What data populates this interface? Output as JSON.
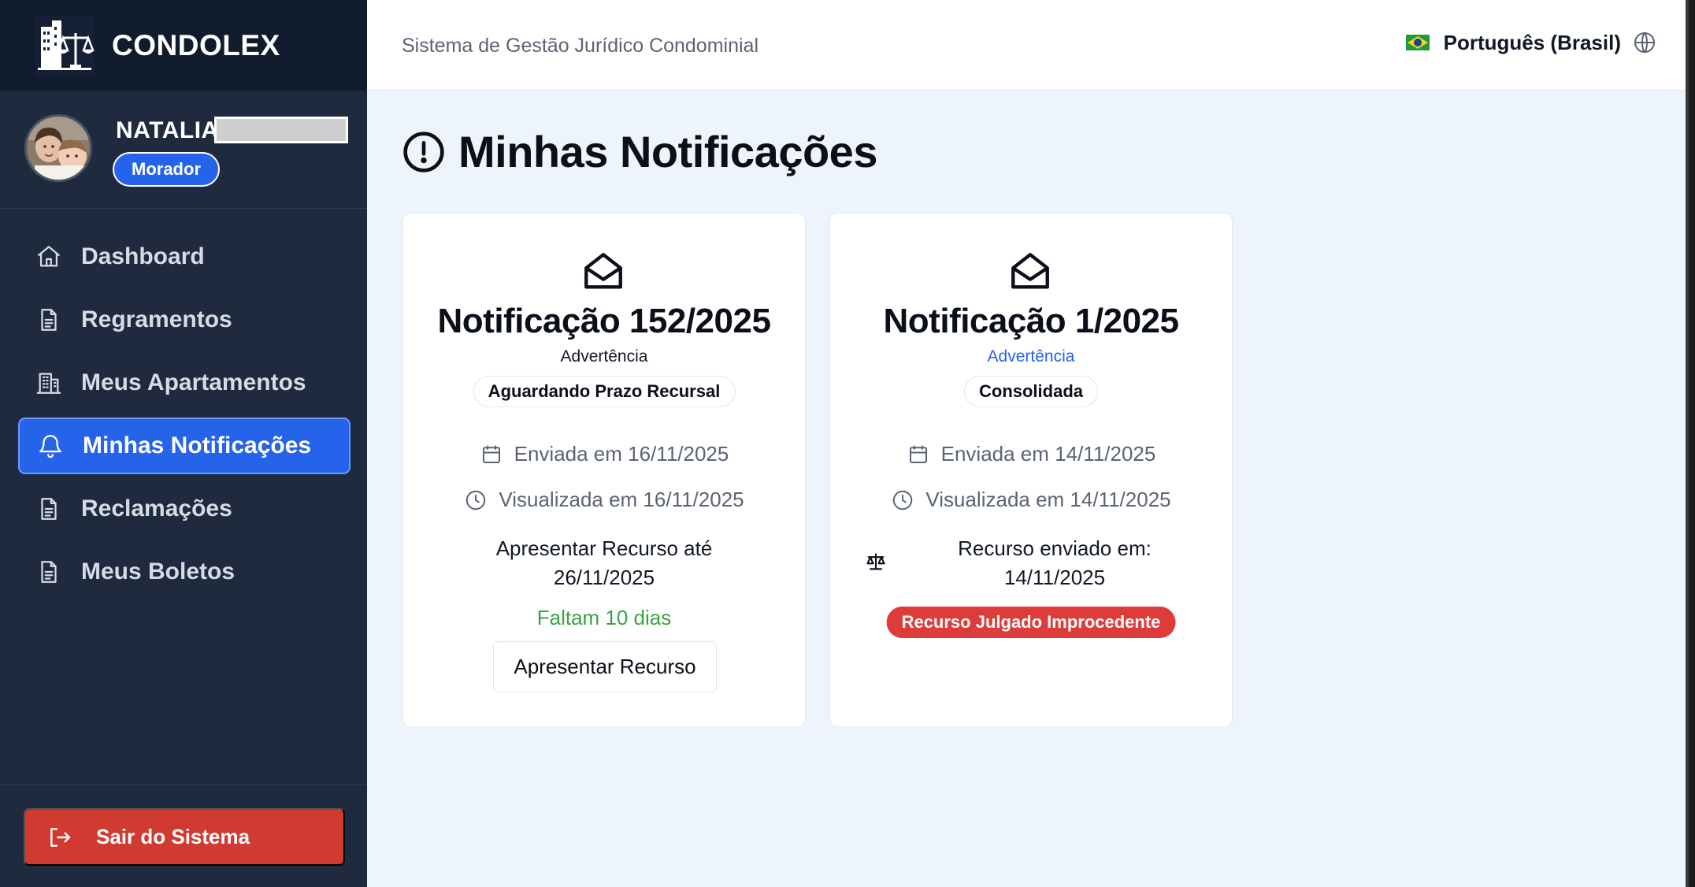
{
  "brand": {
    "name": "CONDOLEX"
  },
  "header": {
    "subtitle": "Sistema de Gestão Jurídico Condominial",
    "language": "Português (Brasil)"
  },
  "user": {
    "name": "NATALIA",
    "role": "Morador"
  },
  "sidebar": {
    "items": [
      {
        "label": "Dashboard",
        "icon": "home-icon"
      },
      {
        "label": "Regramentos",
        "icon": "document-icon"
      },
      {
        "label": "Meus Apartamentos",
        "icon": "building-icon"
      },
      {
        "label": "Minhas Notificações",
        "icon": "bell-icon",
        "active": true
      },
      {
        "label": "Reclamações",
        "icon": "document-icon"
      },
      {
        "label": "Meus Boletos",
        "icon": "document-icon"
      }
    ],
    "logout_label": "Sair do Sistema"
  },
  "page": {
    "title": "Minhas Notificações"
  },
  "notifications": [
    {
      "title": "Notificação 152/2025",
      "type": "Advertência",
      "status": "Aguardando Prazo Recursal",
      "sent": "Enviada em 16/11/2025",
      "viewed": "Visualizada em 16/11/2025",
      "deadline_line1": "Apresentar Recurso até",
      "deadline_line2": "26/11/2025",
      "days_left": "Faltam 10 dias",
      "action_label": "Apresentar Recurso"
    },
    {
      "title": "Notificação 1/2025",
      "type": "Advertência",
      "status": "Consolidada",
      "sent": "Enviada em 14/11/2025",
      "viewed": "Visualizada em 14/11/2025",
      "appeal_line1": "Recurso enviado em:",
      "appeal_line2": "14/11/2025",
      "verdict": "Recurso Julgado Improcedente"
    }
  ],
  "colors": {
    "sidebar_bg": "#1f2a3f",
    "brand_bg": "#111b2e",
    "accent": "#2563eb",
    "danger": "#d03a31",
    "success": "#3aa145",
    "page_bg": "#eef4fc"
  }
}
